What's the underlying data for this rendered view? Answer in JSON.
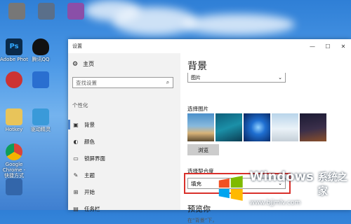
{
  "desktop": {
    "icons": [
      {
        "label": "Adobe Photosho..."
      },
      {
        "label": "腾讯QQ"
      },
      {
        "label": "Hotkey"
      },
      {
        "label": "驱动精灵"
      },
      {
        "label": "Google Chrome - 快捷方式"
      }
    ]
  },
  "window": {
    "title": "设置",
    "minimize": "—",
    "maximize": "☐",
    "close": "✕"
  },
  "sidebar": {
    "home": "主页",
    "search_placeholder": "查找设置",
    "section": "个性化",
    "items": [
      {
        "label": "背景",
        "icon": "image-icon"
      },
      {
        "label": "颜色",
        "icon": "palette-icon"
      },
      {
        "label": "锁屏界面",
        "icon": "monitor-icon"
      },
      {
        "label": "主题",
        "icon": "brush-icon"
      },
      {
        "label": "开始",
        "icon": "start-icon"
      },
      {
        "label": "任务栏",
        "icon": "taskbar-icon"
      }
    ]
  },
  "main": {
    "heading": "背景",
    "background_type": "图片",
    "choose_picture": "选择图片",
    "browse": "浏览",
    "choose_fit": "选择契合度",
    "fit_value": "填充",
    "preview": "预览你",
    "preview_sub": "在“背景”下，"
  },
  "watermark": {
    "brand": "Windows",
    "cn": "系统之家",
    "url": "www.bjjmlv.com"
  }
}
